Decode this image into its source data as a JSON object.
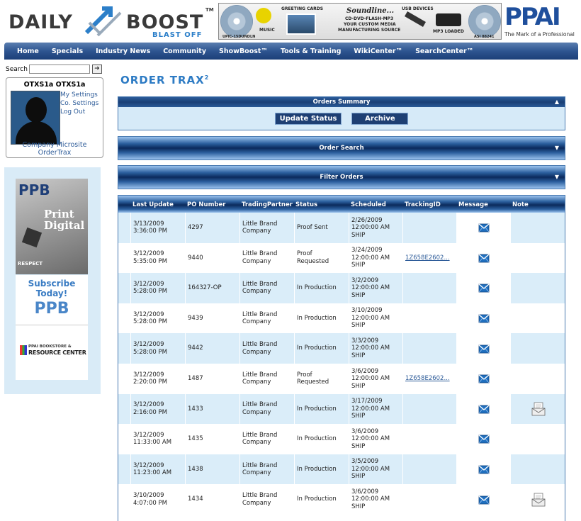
{
  "header": {
    "logo_daily": "DAILY",
    "logo_boost": "BOOST",
    "logo_tagline": "BLAST OFF",
    "logo_tm": "TM",
    "banner": {
      "greeting_cards": "GREETING CARDS",
      "music": "MUSIC",
      "soundline": "Soundline...",
      "soundline_sub1": "CD-DVD-FLASH-MP3",
      "soundline_sub2": "YOUR CUSTOM MEDIA",
      "soundline_sub3": "MANUFACTURING SOURCE",
      "usb": "USB DEVICES",
      "mp3": "MP3 LOADED",
      "upic": "UPIC-15DUNDLN",
      "asi": "ASI 88241"
    },
    "ppai_logo": "PPAI",
    "ppai_tagline": "The Mark of a Professional"
  },
  "nav": [
    "Home",
    "Specials",
    "Industry News",
    "Community",
    "ShowBoost™",
    "Tools & Training",
    "WikiCenter™",
    "SearchCenter™"
  ],
  "search": {
    "label": "Search",
    "value": "",
    "go_label": "➜"
  },
  "profile": {
    "name": "OTXS1a OTXS1a",
    "links": [
      "My Settings",
      "Co. Settings",
      "Log Out"
    ],
    "bottom_links": [
      "Company Microsite",
      "OrderTrax"
    ]
  },
  "ads": {
    "magazine_title": "PPB",
    "magazine_headline": "Print Digital",
    "magazine_footer": "RESPECT",
    "subscribe": "Subscribe Today!",
    "subscribe_logo": "PPB",
    "resource_top": "PPAI BOOKSTORE &",
    "resource_bottom": "RESOURCE CENTER"
  },
  "ordertrax": {
    "name": "ORDER TRAX",
    "sup": "2"
  },
  "panels": {
    "orders_summary": "Orders Summary",
    "update_status": "Update Status",
    "archive": "Archive",
    "order_search": "Order Search",
    "filter_orders": "Filter Orders"
  },
  "table": {
    "columns": [
      "Last Update",
      "PO Number",
      "TradingPartner",
      "Status",
      "Scheduled",
      "TrackingID",
      "Message",
      "Note"
    ],
    "rows": [
      {
        "update": "3/13/2009\n3:36:00 PM",
        "po": "4297",
        "partner": "Little Brand\nCompany",
        "status": "Proof Sent",
        "scheduled": "2/26/2009\n12:00:00 AM\nSHIP",
        "tracking": "",
        "note": false
      },
      {
        "update": "3/12/2009\n5:35:00 PM",
        "po": "9440",
        "partner": "Little Brand\nCompany",
        "status": "Proof\nRequested",
        "scheduled": "3/24/2009\n12:00:00 AM\nSHIP",
        "tracking": "1Z658E2602...",
        "note": false
      },
      {
        "update": "3/12/2009\n5:28:00 PM",
        "po": "164327-OP",
        "partner": "Little Brand\nCompany",
        "status": "In Production",
        "scheduled": "3/2/2009\n12:00:00 AM\nSHIP",
        "tracking": "",
        "note": false
      },
      {
        "update": "3/12/2009\n5:28:00 PM",
        "po": "9439",
        "partner": "Little Brand\nCompany",
        "status": "In Production",
        "scheduled": "3/10/2009\n12:00:00 AM\nSHIP",
        "tracking": "",
        "note": false
      },
      {
        "update": "3/12/2009\n5:28:00 PM",
        "po": "9442",
        "partner": "Little Brand\nCompany",
        "status": "In Production",
        "scheduled": "3/3/2009\n12:00:00 AM\nSHIP",
        "tracking": "",
        "note": false
      },
      {
        "update": "3/12/2009\n2:20:00 PM",
        "po": "1487",
        "partner": "Little Brand\nCompany",
        "status": "Proof\nRequested",
        "scheduled": "3/6/2009\n12:00:00 AM\nSHIP",
        "tracking": "1Z658E2602...",
        "note": false
      },
      {
        "update": "3/12/2009\n2:16:00 PM",
        "po": "1433",
        "partner": "Little Brand\nCompany",
        "status": "In Production",
        "scheduled": "3/17/2009\n12:00:00 AM\nSHIP",
        "tracking": "",
        "note": true
      },
      {
        "update": "3/12/2009\n11:33:00 AM",
        "po": "1435",
        "partner": "Little Brand\nCompany",
        "status": "In Production",
        "scheduled": "3/6/2009\n12:00:00 AM\nSHIP",
        "tracking": "",
        "note": false
      },
      {
        "update": "3/12/2009\n11:23:00 AM",
        "po": "1438",
        "partner": "Little Brand\nCompany",
        "status": "In Production",
        "scheduled": "3/5/2009\n12:00:00 AM\nSHIP",
        "tracking": "",
        "note": false
      },
      {
        "update": "3/10/2009\n4:07:00 PM",
        "po": "1434",
        "partner": "Little Brand\nCompany",
        "status": "In Production",
        "scheduled": "3/6/2009\n12:00:00 AM\nSHIP",
        "tracking": "",
        "note": true
      }
    ]
  },
  "colors": {
    "nav": "#2e5590",
    "accent": "#2d7bc4",
    "link": "#2e5c99",
    "row_alt": "#daedf9"
  }
}
